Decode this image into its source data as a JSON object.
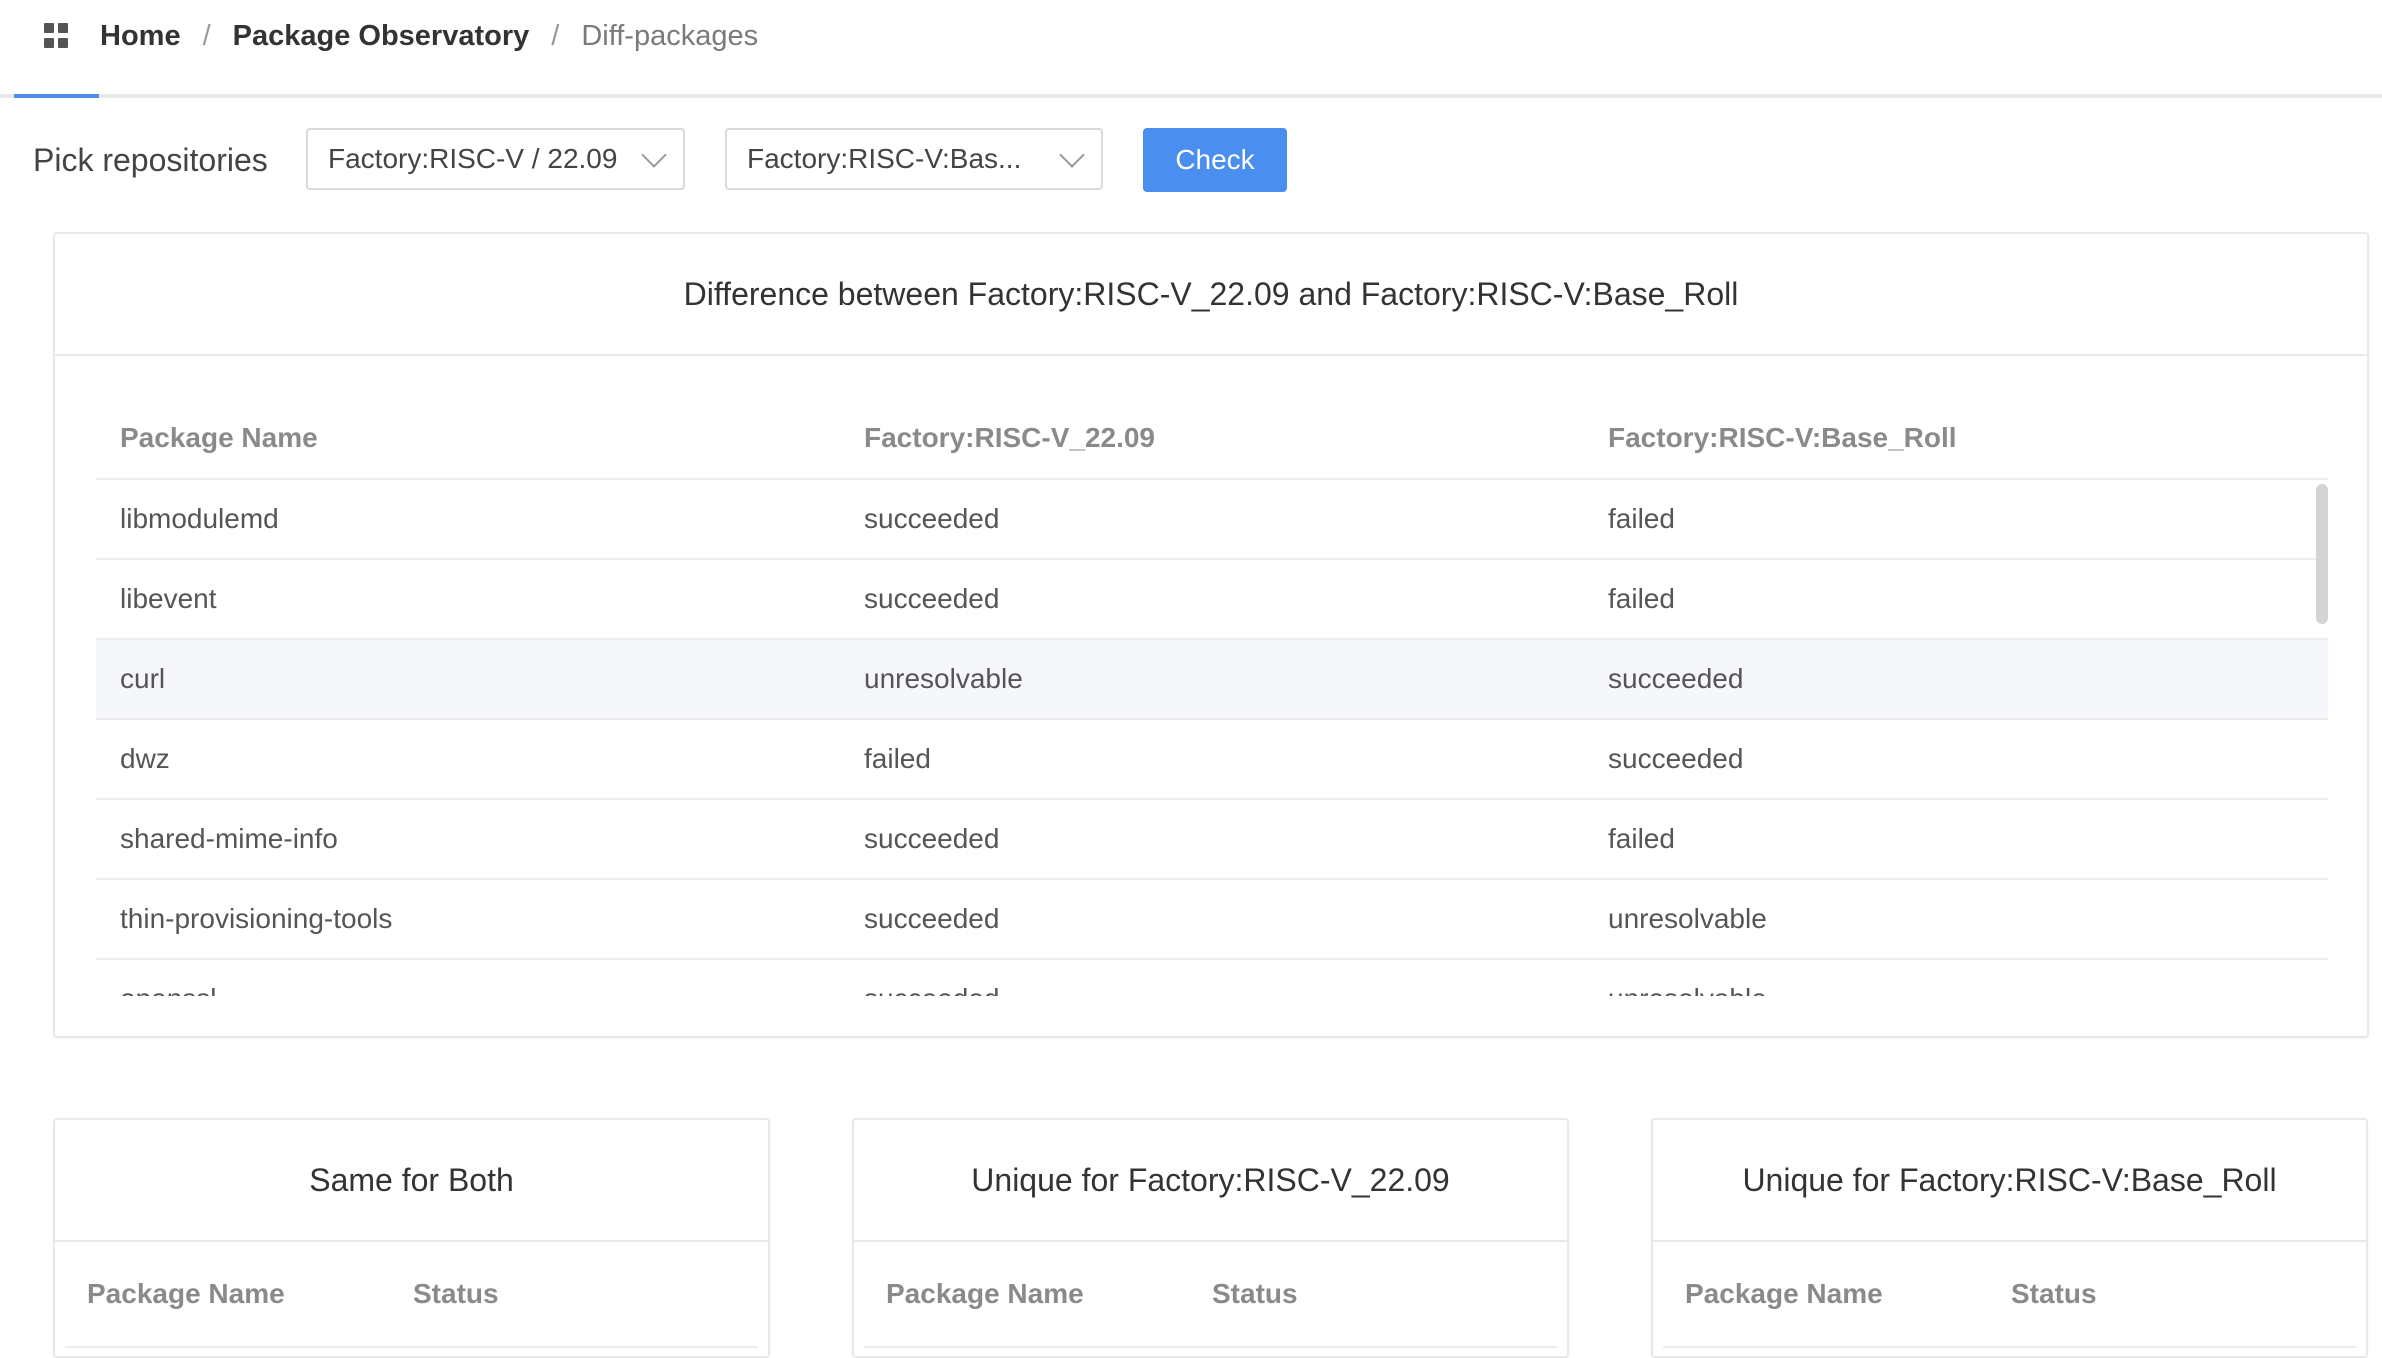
{
  "breadcrumb": {
    "home": "Home",
    "section": "Package Observatory",
    "current": "Diff-packages",
    "separator": "/"
  },
  "picker": {
    "label": "Pick repositories",
    "repo_a": "Factory:RISC-V / 22.09",
    "repo_b": "Factory:RISC-V:Bas...",
    "check_label": "Check"
  },
  "diff": {
    "title": "Difference between Factory:RISC-V_22.09 and Factory:RISC-V:Base_Roll",
    "columns": [
      "Package Name",
      "Factory:RISC-V_22.09",
      "Factory:RISC-V:Base_Roll"
    ],
    "rows": [
      [
        "libmodulemd",
        "succeeded",
        "failed"
      ],
      [
        "libevent",
        "succeeded",
        "failed"
      ],
      [
        "curl",
        "unresolvable",
        "succeeded"
      ],
      [
        "dwz",
        "failed",
        "succeeded"
      ],
      [
        "shared-mime-info",
        "succeeded",
        "failed"
      ],
      [
        "thin-provisioning-tools",
        "succeeded",
        "unresolvable"
      ],
      [
        "openssl",
        "succeeded",
        "unresolvable"
      ]
    ]
  },
  "same_card": {
    "title": "Same for Both",
    "columns": [
      "Package Name",
      "Status"
    ]
  },
  "unique_a_card": {
    "title": "Unique for Factory:RISC-V_22.09",
    "columns": [
      "Package Name",
      "Status"
    ]
  },
  "unique_b_card": {
    "title": "Unique for Factory:RISC-V:Base_Roll",
    "columns": [
      "Package Name",
      "Status"
    ]
  },
  "colors": {
    "accent": "#4a8ef0",
    "border": "#e8e8e8",
    "header_text": "#8a8a8a",
    "hover_row": "#f5f7fa"
  },
  "icons": {
    "apps": "apps-grid-icon",
    "select_arrow": "chevron-down-icon"
  }
}
